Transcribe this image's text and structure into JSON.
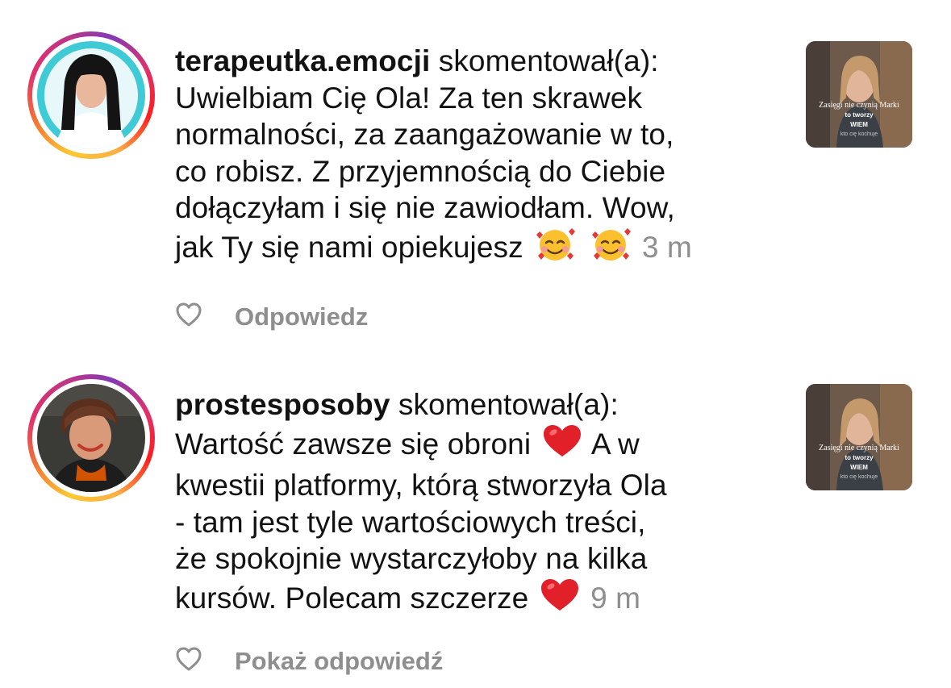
{
  "comments": [
    {
      "username": "terapeutka.emocji",
      "action": "skomentował(a):",
      "lines": [
        "Uwielbiam Cię Ola! Za ten skrawek",
        "normalności, za zaangażowanie w to,",
        "co robisz. Z przyjemnością do Ciebie",
        "dołączyłam i się nie zawiodłam. Wow,",
        "jak Ty się nami opiekujesz"
      ],
      "emojis": [
        "smiling-face-with-hearts",
        "smiling-face-with-hearts"
      ],
      "time": "3 m",
      "reply_label": "Odpowiedz",
      "thumbnail": {
        "caption_line1": "Zasięgi nie czynią Marki",
        "caption_line2": "to tworzy",
        "caption_line3": "WIEM",
        "caption_line4": "kto cię kochuje"
      }
    },
    {
      "username": "prostesposoby",
      "action": "skomentował(a):",
      "lines": [
        "Wartość zawsze się obroni",
        "A w",
        "kwestii platformy, którą stworzyła Ola",
        "- tam jest tyle wartościowych treści,",
        "że spokojnie wystarczyłoby na kilka",
        "kursów. Polecam szczerze"
      ],
      "emojis": [
        "red-heart",
        "red-heart"
      ],
      "time": "9 m",
      "reply_label": "Pokaż odpowiedź",
      "thumbnail": {
        "caption_line1": "Zasięgi nie czynią Marki",
        "caption_line2": "to tworzy",
        "caption_line3": "WIEM",
        "caption_line4": "kto cię kochuje"
      }
    }
  ],
  "colors": {
    "text": "#121212",
    "muted": "#8e8e8e",
    "ring_gradient": [
      "#fdc830",
      "#f37335",
      "#e1306c",
      "#c13584",
      "#833ab4"
    ]
  }
}
